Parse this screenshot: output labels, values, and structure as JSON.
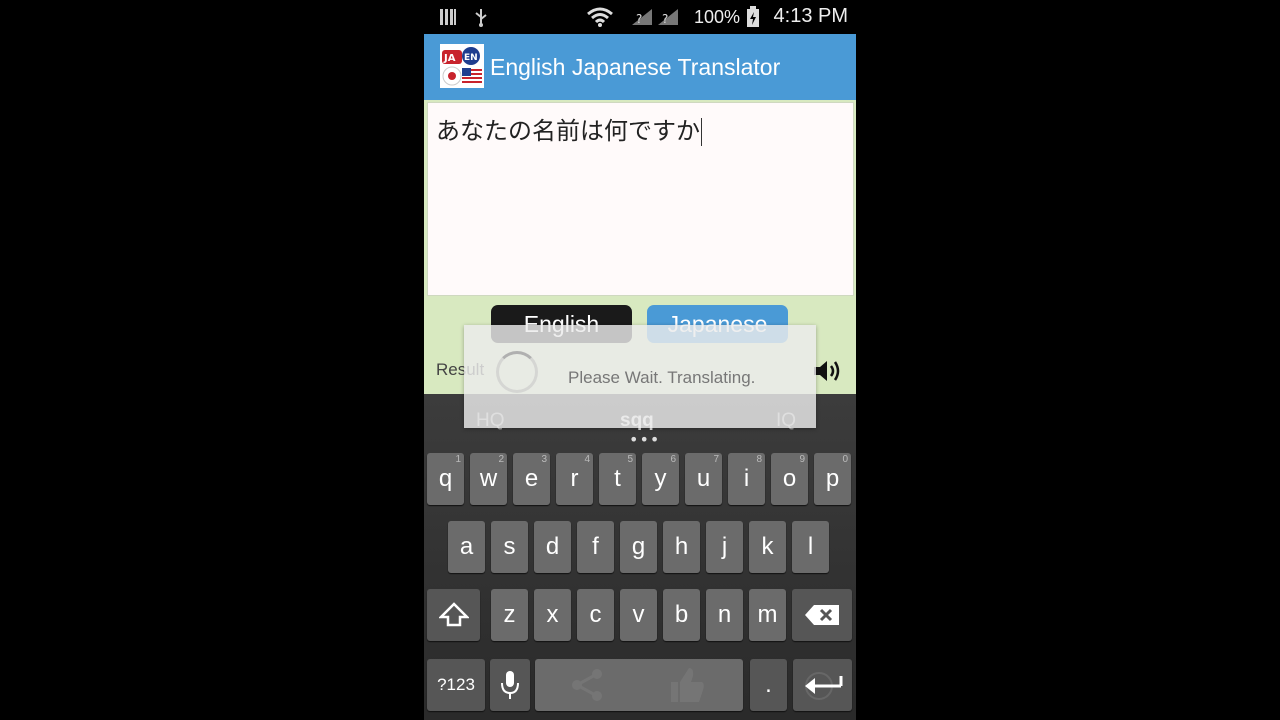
{
  "status_bar": {
    "battery_percent": "100%",
    "time": "4:13 PM",
    "icons": [
      "sim-icon",
      "usb-icon",
      "wifi-icon",
      "no-signal-icon",
      "no-signal-icon",
      "battery-charging-icon"
    ]
  },
  "app": {
    "title": "English Japanese Translator",
    "logo_label_top": "JA",
    "logo_label_bottom": "EN",
    "accent_color": "#4a9ad6"
  },
  "input": {
    "value": "あなたの名前は何ですか"
  },
  "language_buttons": {
    "source": "English",
    "target": "Japanese"
  },
  "result": {
    "label": "Result"
  },
  "dialog": {
    "message": "Please Wait. Translating."
  },
  "keyboard": {
    "suggestions": [
      "HQ",
      "sqq",
      "IQ"
    ],
    "row1": [
      {
        "k": "q",
        "h": "1"
      },
      {
        "k": "w",
        "h": "2"
      },
      {
        "k": "e",
        "h": "3"
      },
      {
        "k": "r",
        "h": "4"
      },
      {
        "k": "t",
        "h": "5"
      },
      {
        "k": "y",
        "h": "6"
      },
      {
        "k": "u",
        "h": "7"
      },
      {
        "k": "i",
        "h": "8"
      },
      {
        "k": "o",
        "h": "9"
      },
      {
        "k": "p",
        "h": "0"
      }
    ],
    "row2": [
      "a",
      "s",
      "d",
      "f",
      "g",
      "h",
      "j",
      "k",
      "l"
    ],
    "row3": [
      "z",
      "x",
      "c",
      "v",
      "b",
      "n",
      "m"
    ],
    "symbols_label": "?123",
    "period_label": "."
  }
}
